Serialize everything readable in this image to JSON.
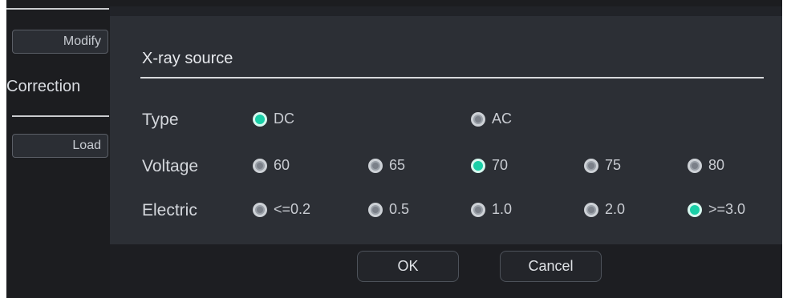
{
  "background": {
    "modify_label": "Modify",
    "correction_label": "Correction",
    "load_label": "Load"
  },
  "dialog": {
    "title": "X-ray source",
    "rows": {
      "type": {
        "label": "Type",
        "options": [
          "DC",
          "AC"
        ],
        "selected": "DC"
      },
      "voltage": {
        "label": "Voltage",
        "options": [
          "60",
          "65",
          "70",
          "75",
          "80"
        ],
        "selected": "70"
      },
      "electric": {
        "label": "Electric",
        "options": [
          "<=0.2",
          "0.5",
          "1.0",
          "2.0",
          ">=3.0"
        ],
        "selected": ">=3.0"
      }
    },
    "ok_label": "OK",
    "cancel_label": "Cancel"
  },
  "colors": {
    "accent": "#19cfa7",
    "dialog_bg": "#2c2f35",
    "app_bg": "#1c1d20"
  }
}
